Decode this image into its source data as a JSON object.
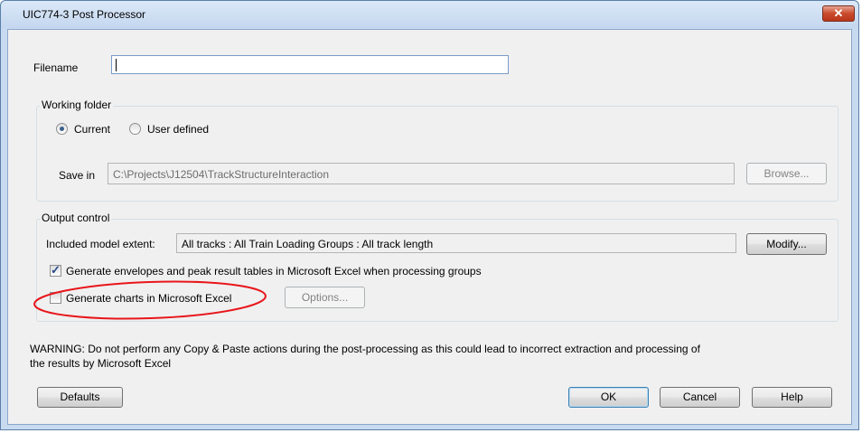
{
  "window": {
    "title": "UIC774-3 Post Processor",
    "close_glyph": "✕"
  },
  "filename": {
    "label": "Filename",
    "value": ""
  },
  "working_folder": {
    "group_label": "Working folder",
    "options": [
      "Current",
      "User defined"
    ],
    "selected": "Current",
    "save_in_label": "Save in",
    "save_in_value": "C:\\Projects\\J12504\\TrackStructureInteraction",
    "browse_label": "Browse..."
  },
  "output_control": {
    "group_label": "Output control",
    "extent_label": "Included model extent:",
    "extent_value": "All tracks : All Train Loading Groups : All track length",
    "modify_label": "Modify...",
    "envelopes_label": "Generate envelopes and peak result tables in Microsoft Excel when processing groups",
    "envelopes_checked": true,
    "charts_label": "Generate charts in Microsoft Excel",
    "charts_checked": false,
    "options_label": "Options...",
    "highlight_color": "#e8161b"
  },
  "warning": {
    "line1": "WARNING: Do not perform any Copy & Paste actions during the post-processing as this could lead to incorrect extraction and processing of",
    "line2": "the results by Microsoft Excel"
  },
  "buttons": {
    "defaults": "Defaults",
    "ok": "OK",
    "cancel": "Cancel",
    "help": "Help"
  }
}
